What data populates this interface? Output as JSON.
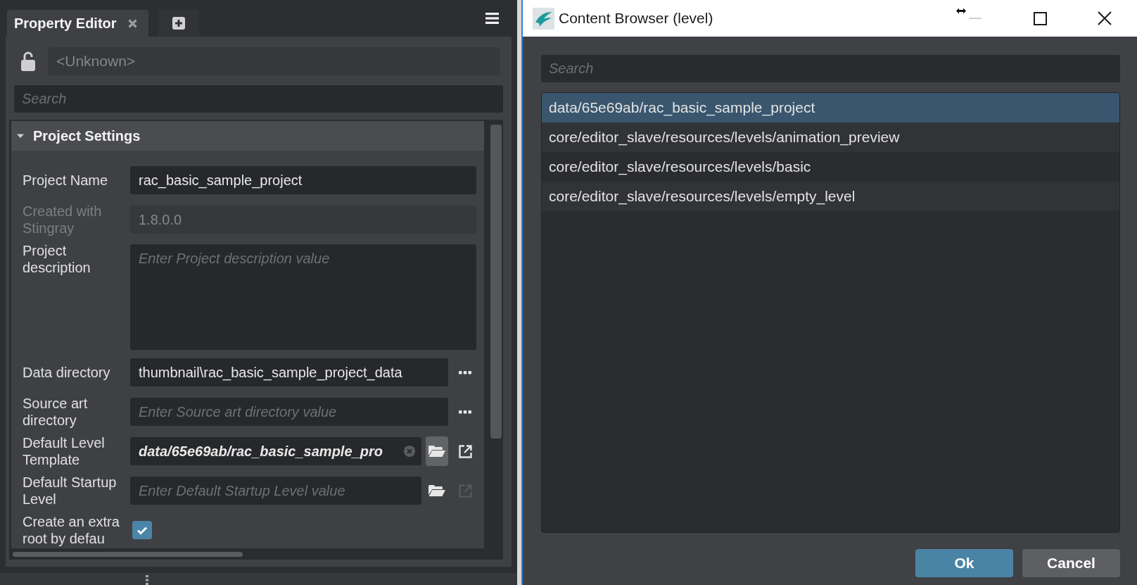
{
  "property_editor": {
    "tabs": [
      {
        "label": "Property Editor",
        "selected": true
      }
    ],
    "locked": false,
    "selection_field": {
      "value": "<Unknown>",
      "disabled": true
    },
    "search": {
      "placeholder": "Search"
    },
    "section": {
      "title": "Project Settings",
      "expanded": true,
      "properties": [
        {
          "kind": "text",
          "label": "Project Name",
          "value": "rac_basic_sample_project",
          "disabled": false
        },
        {
          "kind": "text",
          "label": "Created with Stingray",
          "value": "1.8.0.0",
          "disabled": true
        },
        {
          "kind": "textarea",
          "label": "Project description",
          "placeholder": "Enter Project description value",
          "disabled": false
        },
        {
          "kind": "directory",
          "label": "Data directory",
          "value": "thumbnail\\rac_basic_sample_project_data",
          "disabled": false
        },
        {
          "kind": "directory",
          "label": "Source art directory",
          "placeholder": "Enter Source art directory value",
          "disabled": false
        },
        {
          "kind": "resource",
          "label": "Default Level Template",
          "value": "data/65e69ab/rac_basic_sample_pro",
          "disabled": false,
          "browse_highlighted": true,
          "open_disabled": false
        },
        {
          "kind": "resource",
          "label": "Default Startup Level",
          "placeholder": "Enter Default Startup Level value",
          "disabled": false,
          "browse_highlighted": false,
          "open_disabled": true
        },
        {
          "kind": "checkbox",
          "label": "Create an extra root by defau",
          "checked": true,
          "disabled": false
        }
      ]
    }
  },
  "content_browser": {
    "title": "Content Browser (level)",
    "minimize_disabled": true,
    "search": {
      "placeholder": "Search"
    },
    "items": [
      {
        "label": "data/65e69ab/rac_basic_sample_project",
        "selected": true
      },
      {
        "label": "core/editor_slave/resources/levels/animation_preview",
        "selected": false
      },
      {
        "label": "core/editor_slave/resources/levels/basic",
        "selected": false
      },
      {
        "label": "core/editor_slave/resources/levels/empty_level",
        "selected": false
      }
    ],
    "buttons": [
      {
        "label": "Ok",
        "kind": "primary"
      },
      {
        "label": "Cancel",
        "kind": "secondary"
      }
    ]
  }
}
